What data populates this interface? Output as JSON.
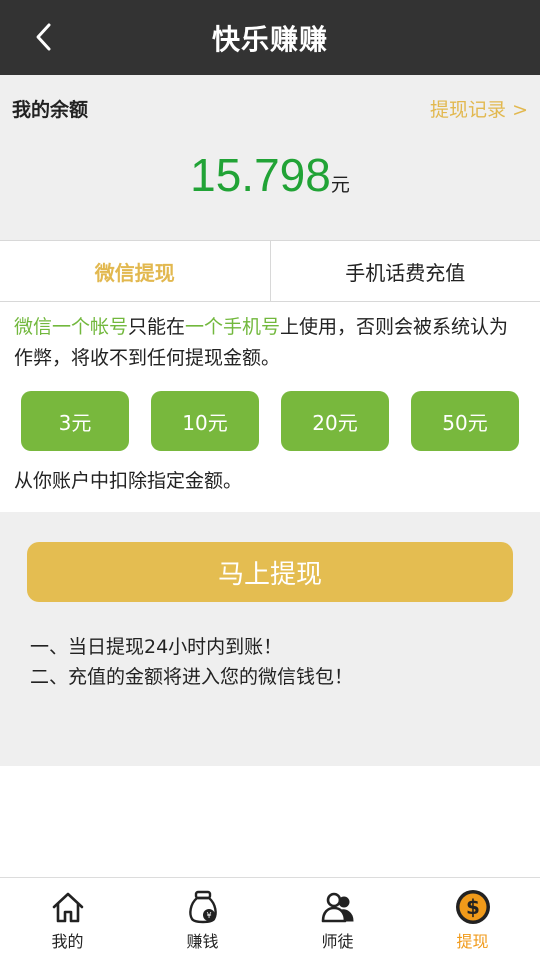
{
  "header": {
    "title": "快乐赚赚",
    "back_icon": "chevron-left-icon"
  },
  "balance": {
    "label": "我的余额",
    "records_link": "提现记录 >",
    "amount": "15.798",
    "unit": "元",
    "colors": {
      "amount": "#21a336",
      "link": "#e2b84f"
    }
  },
  "tabs": [
    {
      "label": "微信提现",
      "active": true
    },
    {
      "label": "手机话费充值",
      "active": false
    }
  ],
  "notice": {
    "part1_hl": "微信一个帐号",
    "part2": "只能在",
    "part3_hl": "一个手机号",
    "part4": "上使用，否则会被系统认为作弊，将收不到任何提现金额。"
  },
  "amount_options": [
    "3元",
    "10元",
    "20元",
    "50元"
  ],
  "deduct_text": "从你账户中扣除指定金额。",
  "withdraw_button": "马上提现",
  "tips": [
    "一、当日提现24小时内到账！",
    "二、充值的金额将进入您的微信钱包！"
  ],
  "bottom_nav": [
    {
      "label": "我的",
      "icon": "home-icon",
      "active": false
    },
    {
      "label": "赚钱",
      "icon": "money-bag-icon",
      "active": false
    },
    {
      "label": "师徒",
      "icon": "users-icon",
      "active": false
    },
    {
      "label": "提现",
      "icon": "dollar-coin-icon",
      "active": true
    }
  ],
  "colors": {
    "header_bg": "#333333",
    "green_button": "#78b83d",
    "gold_button": "#e4bd51",
    "nav_active": "#f09a1a"
  }
}
